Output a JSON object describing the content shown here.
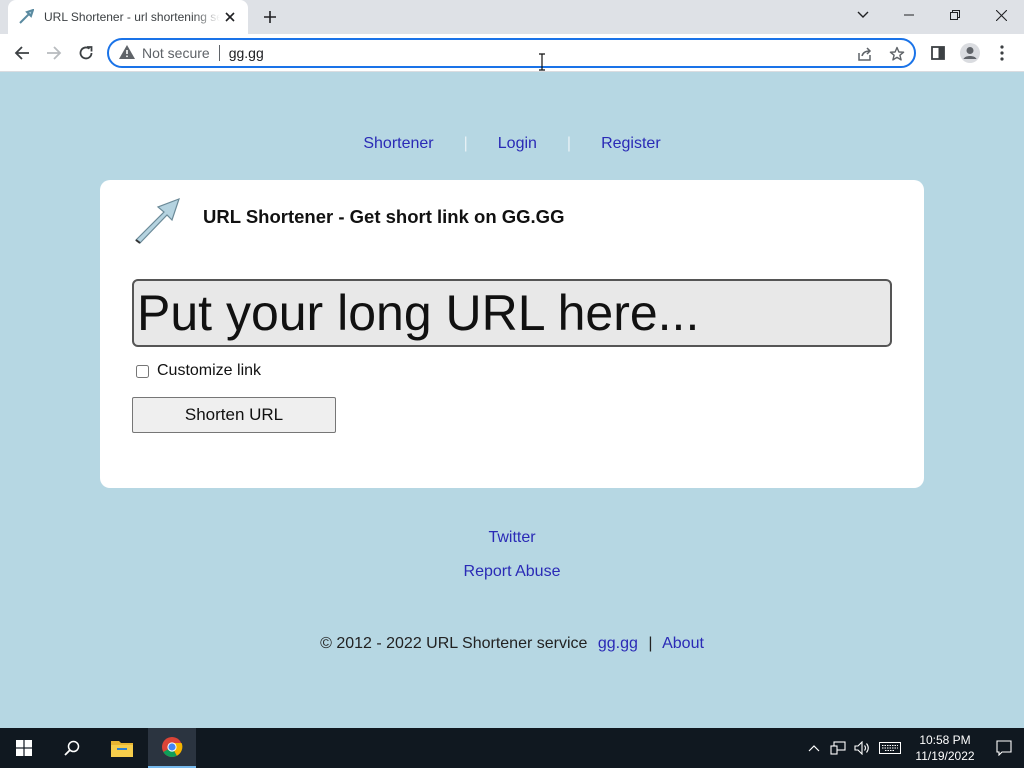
{
  "browser": {
    "tab_title": "URL Shortener - url shortening service",
    "address_warning": "Not secure",
    "url": "gg.gg"
  },
  "nav": {
    "shortener": "Shortener",
    "login": "Login",
    "register": "Register",
    "divider": "|"
  },
  "card": {
    "title": "URL Shortener - Get short link on GG.GG",
    "input_placeholder": "Put your long URL here...",
    "customize_label": "Customize link",
    "customize_checked": false,
    "shorten_button": "Shorten URL"
  },
  "footer": {
    "twitter": "Twitter",
    "report_abuse": "Report Abuse",
    "copyright_text": "© 2012 - 2022 URL Shortener service",
    "site_link": "gg.gg",
    "pipe": "|",
    "about": "About"
  },
  "taskbar": {
    "time": "10:58 PM",
    "date": "11/19/2022"
  },
  "colors": {
    "page_background": "#b6d7e3",
    "link": "#2a2ab6",
    "omnibox_focus": "#1a73e8",
    "taskbar": "#101820"
  },
  "icons": [
    "back-icon",
    "forward-icon",
    "reload-icon",
    "warning-icon",
    "share-icon",
    "star-icon",
    "side-panel-icon",
    "profile-icon",
    "menu-icon",
    "start-icon",
    "search-icon",
    "file-explorer-icon",
    "chrome-icon",
    "notification-icon"
  ]
}
